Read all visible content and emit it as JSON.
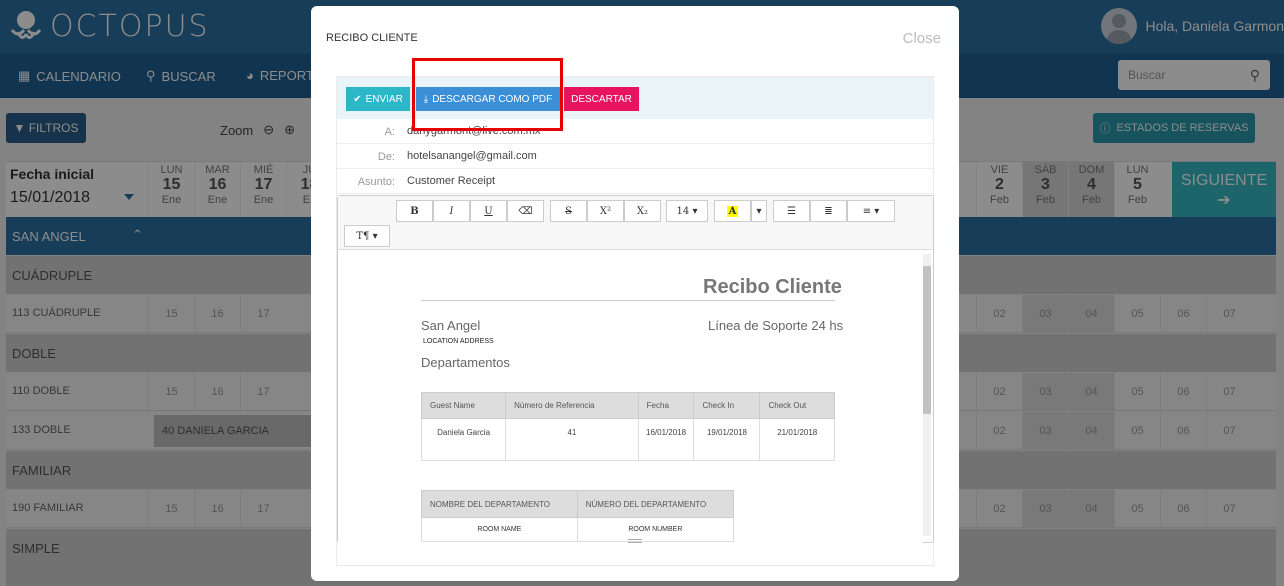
{
  "app": {
    "name": "OCTOPUS",
    "greeting": "Hola, Daniela Garmon"
  },
  "nav": {
    "items": [
      "CALENDARIO",
      "BUSCAR",
      "REPORT"
    ],
    "search_placeholder": "Buscar"
  },
  "toolbar": {
    "filtros": "FILTROS",
    "zoom": "Zoom",
    "estados": "ESTADOS DE RESERVAS"
  },
  "calendar": {
    "fecha_label": "Fecha inicial",
    "fecha_value": "15/01/2018",
    "days": [
      {
        "dow": "LUN",
        "num": "15",
        "mon": "Ene"
      },
      {
        "dow": "MAR",
        "num": "16",
        "mon": "Ene"
      },
      {
        "dow": "MIÉ",
        "num": "17",
        "mon": "Ene"
      },
      {
        "dow": "JU",
        "num": "18",
        "mon": "En"
      }
    ],
    "days_right": [
      {
        "dow": "VIE",
        "num": "2",
        "mon": "Feb"
      },
      {
        "dow": "SÁB",
        "num": "3",
        "mon": "Feb"
      },
      {
        "dow": "DOM",
        "num": "4",
        "mon": "Feb"
      },
      {
        "dow": "LUN",
        "num": "5",
        "mon": "Feb"
      }
    ],
    "siguiente": "SIGUIENTE",
    "group": "SAN ANGEL",
    "categories": [
      "CUÁDRUPLE",
      "DOBLE",
      "FAMILIAR",
      "SIMPLE"
    ],
    "rooms": [
      "113 CUÁDRUPLE",
      "110 DOBLE",
      "133 DOBLE",
      "190 FAMILIAR"
    ],
    "left_cells": [
      "15",
      "16",
      "17"
    ],
    "right_cells": [
      "02",
      "03",
      "04",
      "05",
      "06",
      "07"
    ],
    "booking": "40 DANIELA GARCIA"
  },
  "modal": {
    "title": "RECIBO CLIENTE",
    "close": "Close",
    "buttons": {
      "send": "ENVIAR",
      "pdf": "DESCARGAR COMO PDF",
      "discard": "DESCARTAR"
    },
    "fields": {
      "to_label": "A:",
      "to_value": "danygarmont@live.com.mx",
      "from_label": "De:",
      "from_value": "hotelsanangel@gmail.com",
      "subject_label": "Asunto:",
      "subject_value": "Customer Receipt"
    },
    "editor": {
      "font_size": "14",
      "style_btn": "T"
    },
    "receipt": {
      "title": "Recibo Cliente",
      "hotel": "San Angel",
      "support": "Línea de Soporte 24 hs",
      "location": "LOCATION ADDRESS",
      "section": "Departamentos",
      "table1_headers": [
        "Guest Name",
        "Número de Referencia",
        "Fecha",
        "Check In",
        "Check Out"
      ],
      "table1_row": [
        "Daniela Garcia",
        "41",
        "16/01/2018",
        "19/01/2018",
        "21/01/2018"
      ],
      "table2_headers": [
        "NOMBRE DEL DEPARTAMENTO",
        "NÚMERO DEL DEPARTAMENTO"
      ],
      "table2_row": [
        "ROOM NAME",
        "ROOM NUMBER"
      ]
    }
  }
}
